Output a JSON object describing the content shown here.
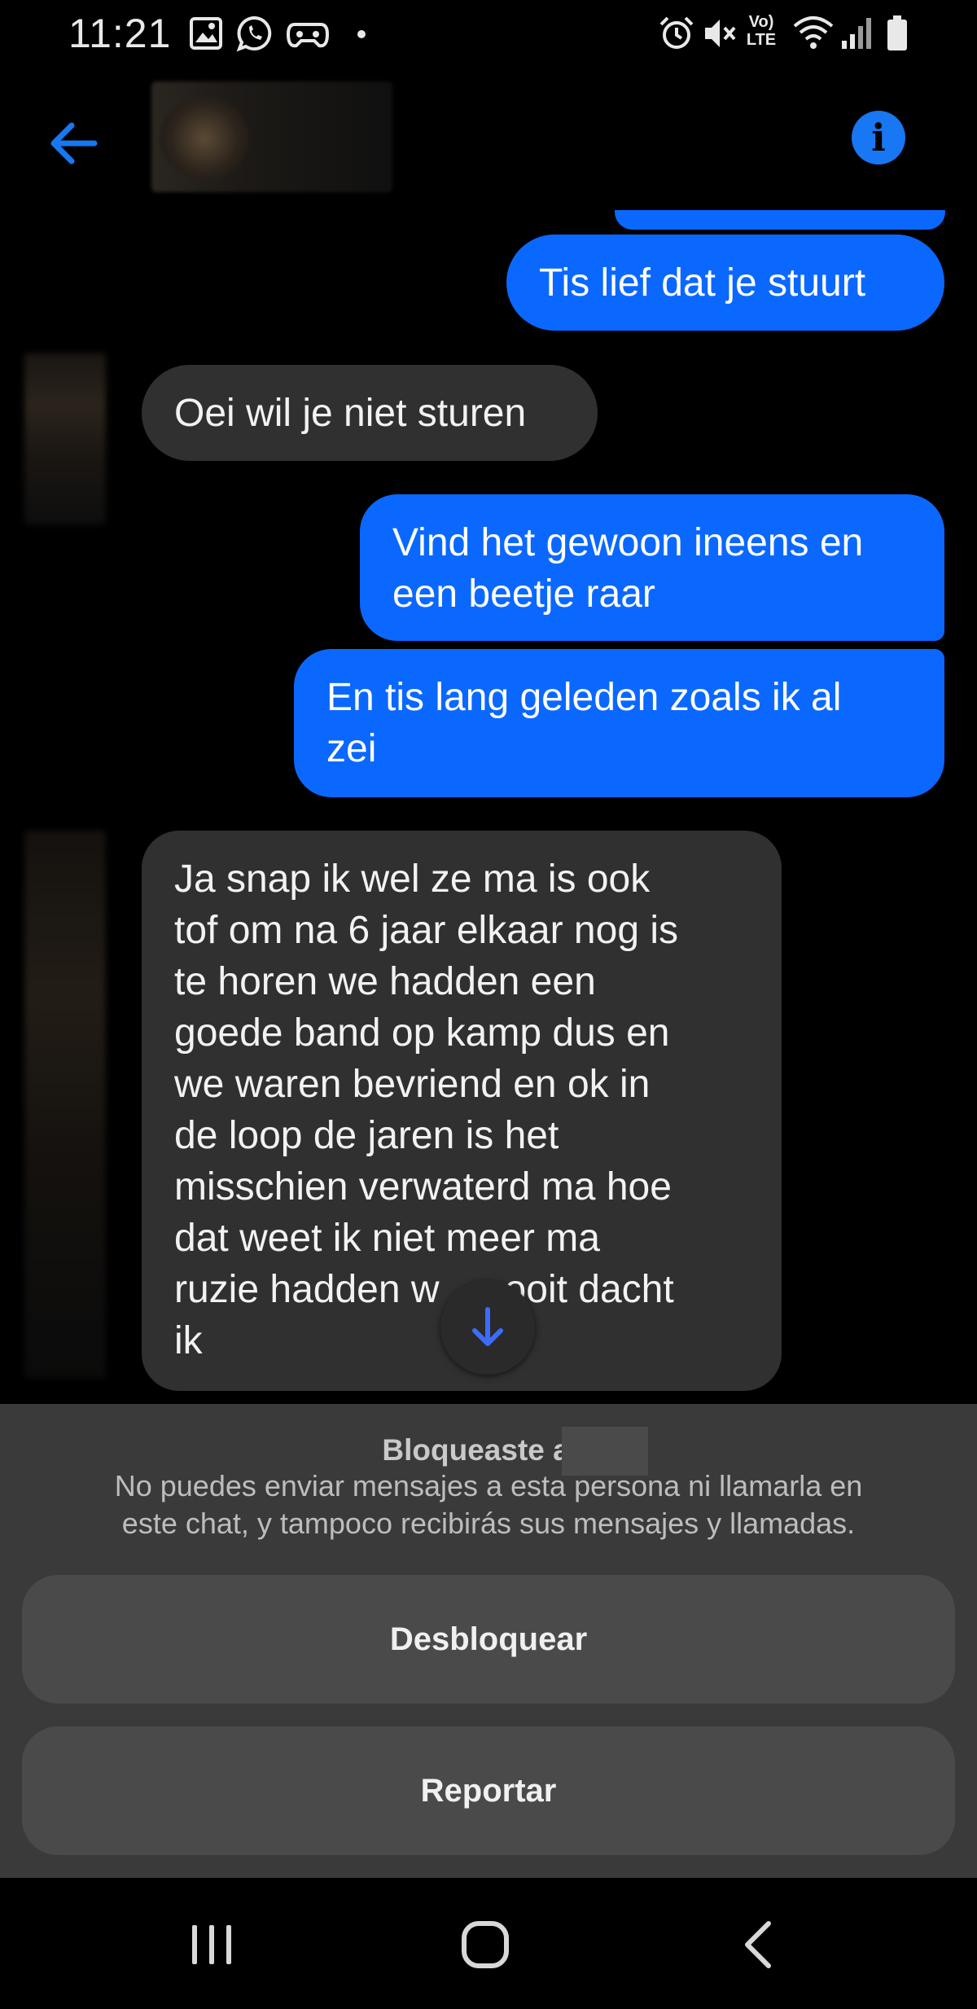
{
  "status_bar": {
    "time": "11:21",
    "icons": [
      "gallery-icon",
      "whatsapp-icon",
      "game-icon",
      "dot-icon",
      "alarm-icon",
      "mute-icon",
      "volte-icon",
      "wifi-icon",
      "signal-icon",
      "battery-icon"
    ],
    "volte_label": "Vo)\nLTE"
  },
  "header": {
    "back_icon": "arrow-left-icon",
    "info_icon": "info-icon",
    "info_label": "i",
    "accent_color": "#1877f2"
  },
  "messages": [
    {
      "direction": "outgoing",
      "text": "Tis lief dat je stuurt"
    },
    {
      "direction": "incoming",
      "text": "Oei wil je niet sturen"
    },
    {
      "direction": "outgoing",
      "lines": [
        "Vind het gewoon ineens en",
        "een beetje raar"
      ]
    },
    {
      "direction": "outgoing",
      "lines": [
        "En tis lang geleden zoals ik al",
        "zei"
      ]
    },
    {
      "direction": "incoming",
      "lines": [
        "Ja snap ik wel ze ma is ook",
        "tof om na 6 jaar elkaar nog is",
        "te horen we hadden een",
        "goede band op kamp dus en",
        "we waren bevriend en ok in",
        "de loop de jaren is het",
        "misschien verwaterd ma hoe",
        "dat weet ik niet meer ma",
        "ruzie hadden w",
        "ooit dacht",
        "ik"
      ]
    }
  ],
  "scroll_down_icon": "arrow-down-icon",
  "blocked": {
    "title": "Bloqueaste a J",
    "description_lines": [
      "No puedes enviar mensajes a esta persona ni llamarla en",
      "este chat, y tampoco recibirás sus mensajes y llamadas."
    ],
    "unblock_label": "Desbloquear",
    "report_label": "Reportar"
  },
  "nav_bar": {
    "icons": [
      "recents-icon",
      "home-icon",
      "back-icon"
    ]
  },
  "colors": {
    "outgoing_bubble": "#0b68ff",
    "incoming_bubble": "#303030",
    "panel": "#3a3a3a",
    "button": "#4a4a4a"
  }
}
